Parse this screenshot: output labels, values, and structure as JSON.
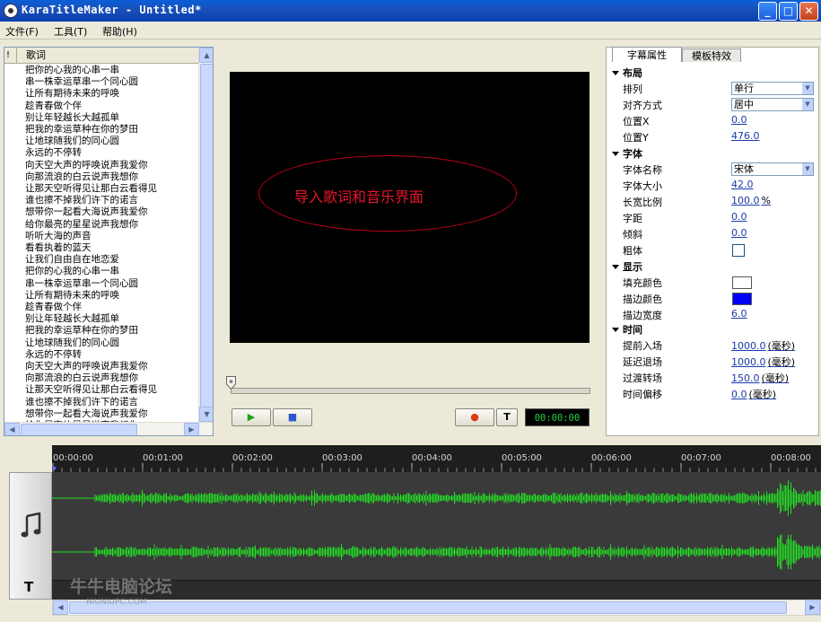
{
  "window": {
    "title": "KaraTitleMaker - Untitled*",
    "minimize_glyph": "_",
    "maximize_glyph": "□",
    "close_glyph": "✕"
  },
  "menu": [
    {
      "label": "文件(F)"
    },
    {
      "label": "工具(T)"
    },
    {
      "label": "帮助(H)"
    }
  ],
  "lyrics": {
    "col_marker": "!",
    "header": "歌词",
    "lines": [
      "把你的心我的心串一串",
      "串一株幸运草串一个同心圆",
      "让所有期待未来的呼唤",
      "趁青春做个伴",
      "别让年轻越长大越孤单",
      "把我的幸运草种在你的梦田",
      "让地球随我们的同心圆",
      "永远的不停转",
      "向天空大声的呼唤说声我爱你",
      "向那流浪的白云说声我想你",
      "让那天空听得见让那白云看得见",
      "谁也擦不掉我们许下的诺言",
      "想带你一起看大海说声我爱你",
      "给你最亮的星星说声我想你",
      "听听大海的声音",
      "看看执着的蓝天",
      "让我们自由自在地恋爱",
      "把你的心我的心串一串",
      "串一株幸运草串一个同心圆",
      "让所有期待未来的呼唤",
      "趁青春做个伴",
      "别让年轻越长大越孤单",
      "把我的幸运草种在你的梦田",
      "让地球随我们的同心圆",
      "永远的不停转",
      "向天空大声的呼唤说声我爱你",
      "向那流浪的白云说声我想你",
      "让那天空听得见让那白云看得见",
      "谁也擦不掉我们许下的诺言",
      "想带你一起看大海说声我爱你",
      "给你最亮的星星说声我想你"
    ]
  },
  "preview": {
    "caption": "导入歌词和音乐界面",
    "progress": 0
  },
  "controls": {
    "play_glyph": "▶",
    "stop_glyph": "■",
    "record_glyph": "●",
    "text_label": "T",
    "time": "00:00:00"
  },
  "props": {
    "tabs": [
      "字幕属性",
      "模板特效"
    ],
    "sections": {
      "layout": "布局",
      "font": "字体",
      "display": "显示",
      "time": "时间"
    },
    "rows": {
      "arrangement_label": "排列",
      "arrangement_value": "单行",
      "align_label": "对齐方式",
      "align_value": "居中",
      "pos_x_label": "位置X",
      "pos_x_value": "0.0",
      "pos_y_label": "位置Y",
      "pos_y_value": "476.0",
      "font_name_label": "字体名称",
      "font_name_value": "宋体",
      "font_size_label": "字体大小",
      "font_size_value": "42.0",
      "aspect_label": "长宽比例",
      "aspect_value": "100.0",
      "aspect_unit": "%",
      "spacing_label": "字距",
      "spacing_value": "0.0",
      "tilt_label": "倾斜",
      "tilt_value": "0.0",
      "bold_label": "粗体",
      "fill_label": "填充颜色",
      "fill_color": "#ffffff",
      "stroke_label": "描边颜色",
      "stroke_color": "#0000ff",
      "stroke_width_label": "描边宽度",
      "stroke_width_value": "6.0",
      "advance_in_label": "提前入场",
      "advance_in_value": "1000.0",
      "delay_out_label": "延迟退场",
      "delay_out_value": "1000.0",
      "transition_label": "过渡转场",
      "transition_value": "150.0",
      "offset_label": "时间偏移",
      "offset_value": "0.0",
      "ms_unit": "(毫秒)"
    }
  },
  "timeline": {
    "ticks": [
      "00:00:00",
      "00:01:00",
      "00:02:00",
      "00:03:00",
      "00:04:00",
      "00:05:00",
      "00:06:00",
      "00:07:00",
      "00:08:00"
    ],
    "audio_track_icon": "music-note-icon",
    "text_track_label": "T",
    "waveform_color": "#22e022"
  },
  "watermark": {
    "text": "牛牛电脑论坛",
    "url": "NIUNIUPC.COM"
  }
}
